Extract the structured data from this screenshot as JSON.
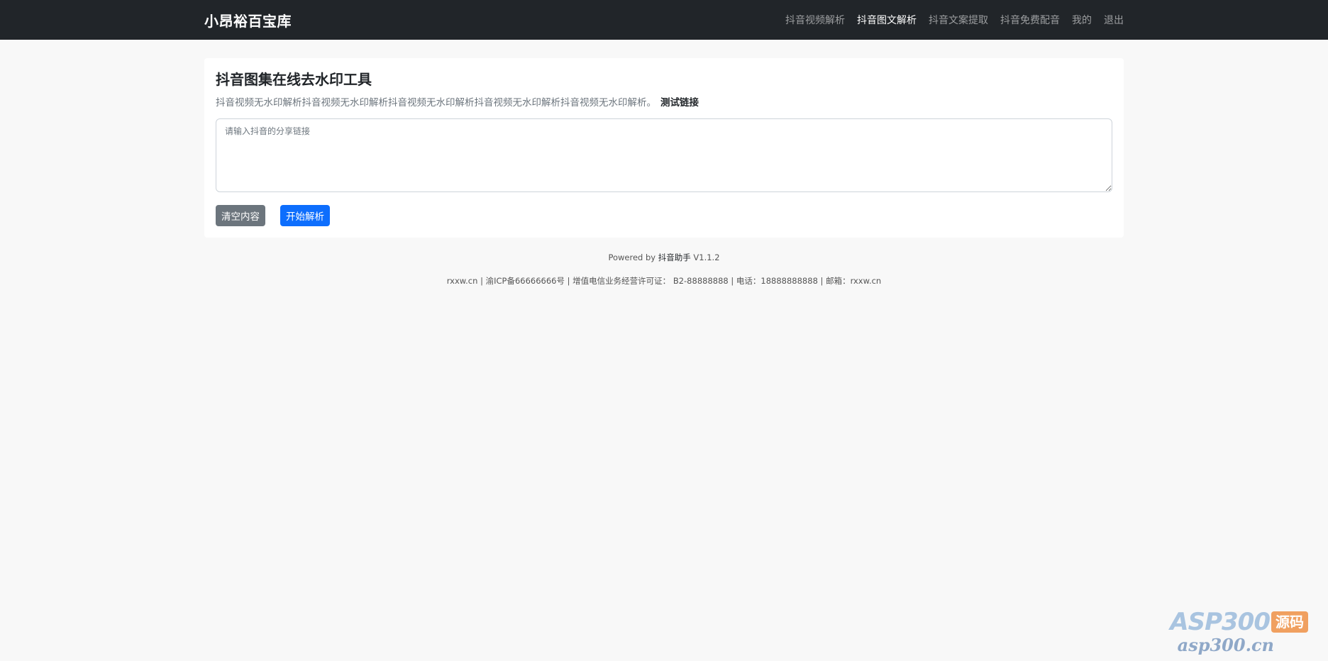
{
  "navbar": {
    "brand": "小昂裕百宝库",
    "links": [
      {
        "label": "抖音视频解析",
        "active": false
      },
      {
        "label": "抖音图文解析",
        "active": true
      },
      {
        "label": "抖音文案提取",
        "active": false
      },
      {
        "label": "抖音免费配音",
        "active": false
      },
      {
        "label": "我的",
        "active": false
      },
      {
        "label": "退出",
        "active": false
      }
    ]
  },
  "tool": {
    "title": "抖音图集在线去水印工具",
    "description": "抖音视频无水印解析抖音视频无水印解析抖音视频无水印解析抖音视频无水印解析抖音视频无水印解析。",
    "test_link": "测试链接",
    "input_placeholder": "请输入抖音的分享链接",
    "input_value": "",
    "clear_button": "清空内容",
    "parse_button": "开始解析"
  },
  "footer": {
    "powered_prefix": "Powered by ",
    "powered_app": "抖音助手",
    "version": " V1.1.2",
    "icp_line": "rxxw.cn | 渝ICP备66666666号 | 增值电信业务经营许可证： B2-88888888 | 电话：18888888888 | 邮箱：rxxw.cn"
  },
  "watermark": {
    "asp": "ASP300",
    "badge": "源码",
    "url": "asp300.cn"
  },
  "colors": {
    "navbar_bg": "#212529",
    "page_bg": "#f8f8f8",
    "primary": "#0d6efd",
    "secondary": "#6c757d"
  }
}
